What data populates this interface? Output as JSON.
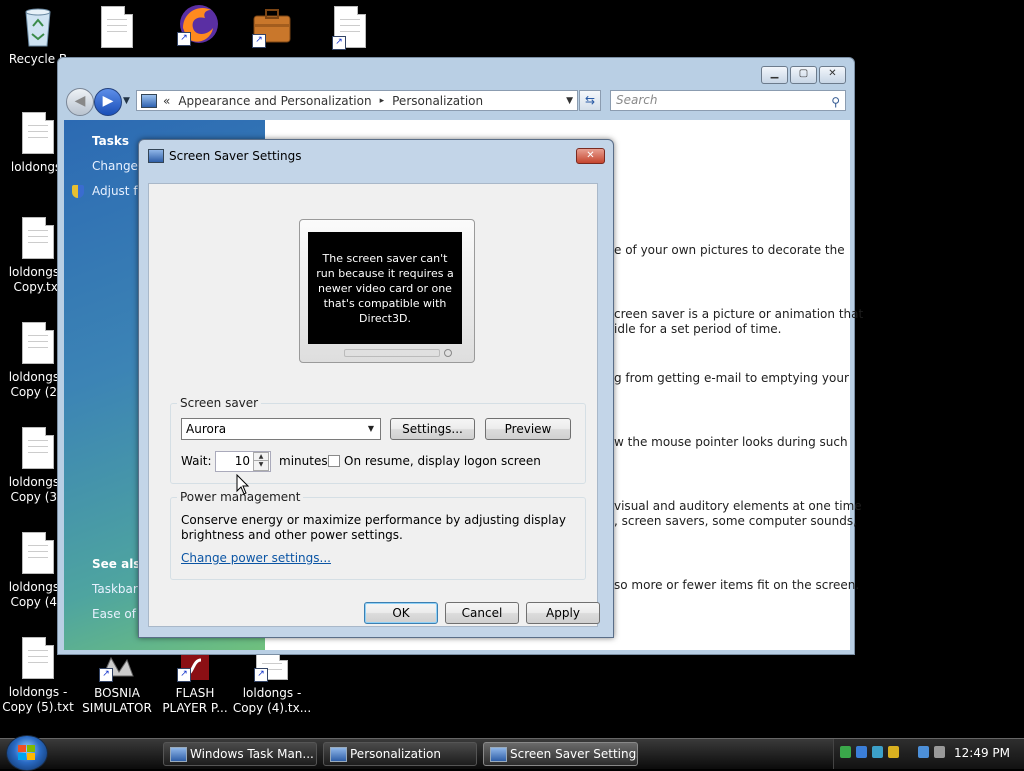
{
  "desktop": {
    "icons": [
      {
        "label": "Recycle B",
        "type": "recycle"
      },
      {
        "label": "",
        "type": "file"
      },
      {
        "label": "",
        "type": "firefox"
      },
      {
        "label": "",
        "type": "briefcase"
      },
      {
        "label": "",
        "type": "file"
      },
      {
        "label": "loldongs.",
        "type": "file"
      },
      {
        "label": "loldongs -\nCopy.txt",
        "type": "file"
      },
      {
        "label": "loldongs -\nCopy (2).",
        "type": "file"
      },
      {
        "label": "loldongs -\nCopy (3).",
        "type": "file"
      },
      {
        "label": "loldongs -\nCopy (4).",
        "type": "file"
      },
      {
        "label": "loldongs -\nCopy (5).txt",
        "type": "file"
      },
      {
        "label": "BOSNIA\nSIMULATOR",
        "type": "app"
      },
      {
        "label": "FLASH\nPLAYER P...",
        "type": "app"
      },
      {
        "label": "loldongs -\nCopy (4).tx...",
        "type": "file"
      }
    ]
  },
  "explorer": {
    "address": {
      "chevron": "«",
      "seg1": "Appearance and Personalization",
      "sep": "▸",
      "seg2": "Personalization"
    },
    "search_placeholder": "Search",
    "sidebar": {
      "tasks_title": "Tasks",
      "tasks": [
        "Change",
        "Adjust fo"
      ],
      "see_also_title": "See also",
      "see_also": [
        "Taskbar",
        "Ease of A"
      ]
    },
    "content_lines": [
      "e of your own pictures to decorate the",
      "creen saver is a picture or animation that",
      "idle for a set period of time.",
      "g from getting e-mail to emptying your",
      "w the mouse pointer looks during such",
      "visual and auditory elements at one time",
      ", screen savers, some computer sounds,",
      "so more or fewer items fit on the screen."
    ]
  },
  "dialog": {
    "title": "Screen Saver Settings",
    "preview_message": "The screen saver can't run because it requires a newer video card or one that's compatible with Direct3D.",
    "screensaver_group": "Screen saver",
    "selected_saver": "Aurora",
    "settings_button": "Settings...",
    "preview_button": "Preview",
    "wait_label": "Wait:",
    "wait_value": "10",
    "minutes_label": "minutes",
    "resume_checkbox_label": "On resume, display logon screen",
    "resume_checked": false,
    "power_group": "Power management",
    "power_text_1": "Conserve energy or maximize performance by adjusting display",
    "power_text_2": "brightness and other power settings.",
    "power_link": "Change power settings...",
    "ok": "OK",
    "cancel": "Cancel",
    "apply": "Apply"
  },
  "taskbar": {
    "buttons": [
      {
        "label": "Windows Task Man..."
      },
      {
        "label": "Personalization"
      },
      {
        "label": "Screen Saver Settings"
      }
    ],
    "clock": "12:49 PM"
  }
}
